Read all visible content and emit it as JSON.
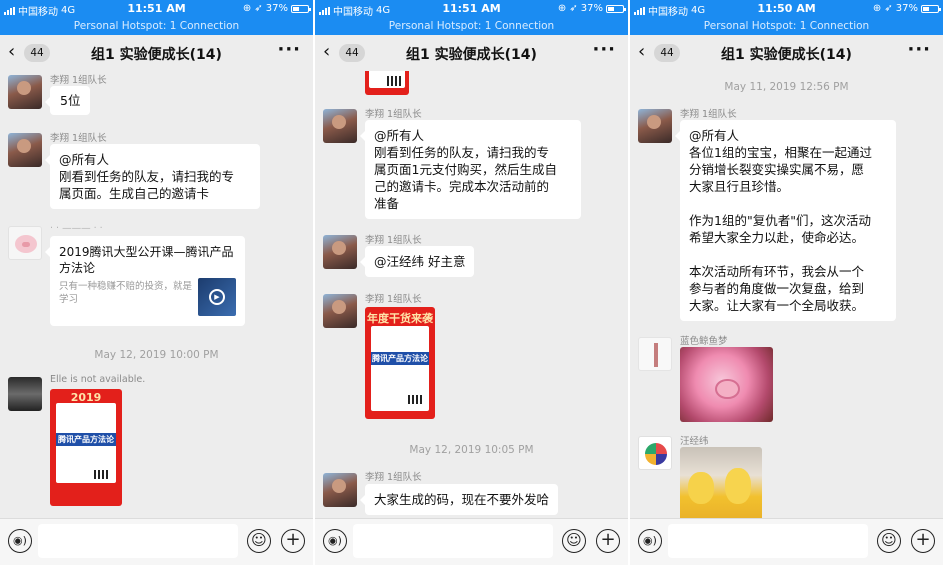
{
  "status": {
    "carrier": "中国移动",
    "network": "4G",
    "battery": "37%",
    "battery_fraction": 0.37
  },
  "hotspot": "Personal Hotspot: 1 Connection",
  "nav": {
    "back_icon": "chevron-left-icon",
    "unread": "44",
    "title": "组1 实验便成长(14)",
    "more": "···"
  },
  "panels": [
    {
      "time": "11:51 AM",
      "messages": {
        "m1_sender": "李翔 1组队长",
        "m1_text": "5位",
        "m2_sender": "李翔 1组队长",
        "m2_l1": "@所有人",
        "m2_l2": "刚看到任务的队友，请扫我的专",
        "m2_l3": "属页面。生成自己的邀请卡",
        "m3_sender": "· · ——— · ·",
        "card_title": "2019腾讯大型公开课—腾讯产品方法论",
        "card_desc": "只有一种稳赚不赔的投资，就是学习",
        "ts": "May 12, 2019 10:00 PM",
        "m4_sender": "Elle is not available.",
        "poster_year": "2019",
        "poster_band": "腾讯产品方法论"
      }
    },
    {
      "time": "11:51 AM",
      "messages": {
        "m1_sender": "李翔 1组队长",
        "m1_l1": "@所有人",
        "m1_l2": "刚看到任务的队友，请扫我的专",
        "m1_l3": "属页面1元支付购买，然后生成自",
        "m1_l4": "己的邀请卡。完成本次活动前的",
        "m1_l5": "准备",
        "m2_sender": "李翔 1组队长",
        "m2_text": "@汪经纬 好主意",
        "m3_sender": "李翔 1组队长",
        "poster_head": "年度干货来袭",
        "poster_band": "腾讯产品方法论",
        "ts": "May 12, 2019 10:05 PM",
        "m4_sender": "李翔 1组队长",
        "m4_text": "大家生成的码，现在不要外发哈"
      }
    },
    {
      "time": "11:50 AM",
      "messages": {
        "ts": "May 11, 2019 12:56 PM",
        "m1_sender": "李翔 1组队长",
        "m1_l1": "@所有人",
        "m1_l2": "各位1组的宝宝，相聚在一起通过",
        "m1_l3": "分销增长裂变实操实属不易，愿",
        "m1_l4": "大家且行且珍惜。",
        "m1_l5": "作为1组的\"复仇者\"们，这次活动",
        "m1_l6": "希望大家全力以赴，使命必达。",
        "m1_l7": "本次活动所有环节，我会从一个",
        "m1_l8": "参与者的角度做一次复盘，给到",
        "m1_l9": "大家。让大家有一个全局收获。",
        "m2_sender": "蓝色鲸鱼梦",
        "m3_sender": "汪经纬"
      }
    }
  ],
  "input_bar": {
    "voice_icon": "voice-icon",
    "emoji_icon": "emoji-icon",
    "plus_icon": "plus-icon"
  }
}
